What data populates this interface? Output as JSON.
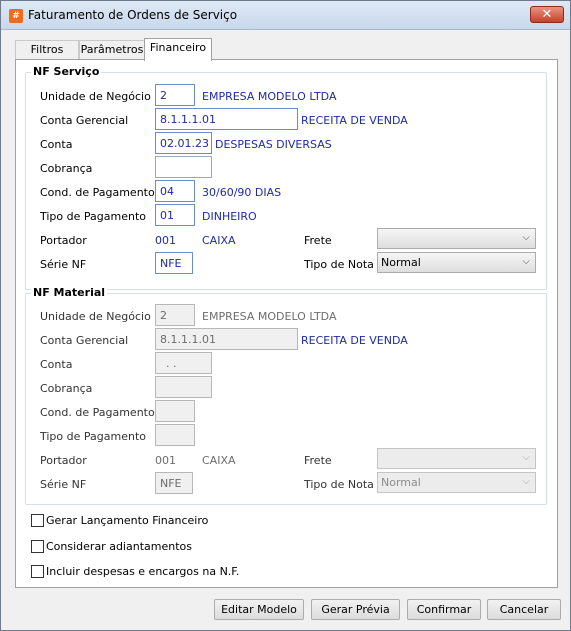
{
  "window": {
    "title": "Faturamento de Ordens de Serviço",
    "close": "✕",
    "app_icon": "#"
  },
  "tabs": [
    {
      "label": "Filtros"
    },
    {
      "label": "Parâmetros"
    },
    {
      "label": "Financeiro"
    }
  ],
  "nf_servico": {
    "title": "NF Serviço",
    "unidade_label": "Unidade de Negócio",
    "unidade_code": "2",
    "unidade_name": "EMPRESA MODELO LTDA",
    "conta_ger_label": "Conta Gerencial",
    "conta_ger_code": "8.1.1.1.01",
    "conta_ger_name": "RECEITA DE VENDA",
    "conta_label": "Conta",
    "conta_code": "02.01.23",
    "conta_name": "DESPESAS DIVERSAS",
    "cobranca_label": "Cobrança",
    "cobranca_value": "",
    "cond_label": "Cond. de Pagamento",
    "cond_code": "04",
    "cond_name": "30/60/90 DIAS",
    "tipo_label": "Tipo de Pagamento",
    "tipo_code": "01",
    "tipo_name": "DINHEIRO",
    "portador_label": "Portador",
    "portador_code": "001",
    "portador_name": "CAIXA",
    "frete_label": "Frete",
    "frete_value": "",
    "serie_label": "Série NF",
    "serie_value": "NFE",
    "tipo_nota_label": "Tipo de Nota",
    "tipo_nota_value": "Normal"
  },
  "nf_material": {
    "title": "NF Material",
    "unidade_label": "Unidade de Negócio",
    "unidade_code": "2",
    "unidade_name": "EMPRESA MODELO LTDA",
    "conta_ger_label": "Conta Gerencial",
    "conta_ger_code": "8.1.1.1.01",
    "conta_ger_name": "RECEITA DE VENDA",
    "conta_label": "Conta",
    "conta_code": ". .",
    "cobranca_label": "Cobrança",
    "cond_label": "Cond. de Pagamento",
    "tipo_label": "Tipo de Pagamento",
    "portador_label": "Portador",
    "portador_code": "001",
    "portador_name": "CAIXA",
    "frete_label": "Frete",
    "frete_value": "",
    "serie_label": "Série NF",
    "serie_value": "NFE",
    "tipo_nota_label": "Tipo de Nota",
    "tipo_nota_value": "Normal"
  },
  "options": {
    "gerar": "Gerar Lançamento Financeiro",
    "adiantamentos": "Considerar adiantamentos",
    "despesas": "Incluir despesas e encargos na N.F."
  },
  "buttons": {
    "editar": "Editar Modelo",
    "previa": "Gerar Prévia",
    "confirmar": "Confirmar",
    "cancelar": "Cancelar"
  },
  "icons": {
    "dropdown": "chevron-down-icon"
  },
  "colors": {
    "value_text": "#1f2aa3",
    "titlebar": "#c8d8ec",
    "close": "#c7422a"
  }
}
